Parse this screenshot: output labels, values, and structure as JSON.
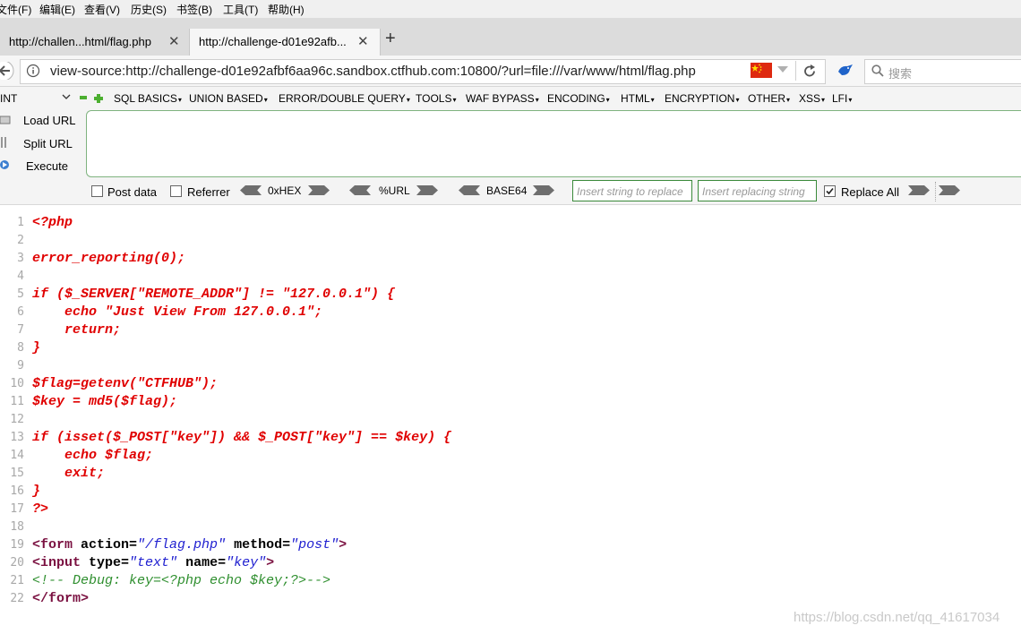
{
  "menu": [
    "文件(F)",
    "编辑(E)",
    "查看(V)",
    "历史(S)",
    "书签(B)",
    "工具(T)",
    "帮助(H)"
  ],
  "tabs": [
    {
      "title": "http://challen...html/flag.php",
      "active": false
    },
    {
      "title": "http://challenge-d01e92afb...",
      "active": true
    }
  ],
  "address": {
    "url": "view-source:http://challenge-d01e92afbf6aa96c.sandbox.ctfhub.com:10800/?url=file:///var/www/html/flag.php"
  },
  "search": {
    "placeholder": "搜索"
  },
  "hackbar": {
    "select_value": "INT",
    "menus": [
      "SQL BASICS",
      "UNION BASED",
      "ERROR/DOUBLE QUERY",
      "TOOLS",
      "WAF BYPASS",
      "ENCODING",
      "HTML",
      "ENCRYPTION",
      "OTHER",
      "XSS",
      "LFI"
    ],
    "load_url": "Load URL",
    "split_url": "Split URL",
    "execute": "Execute",
    "post_data": "Post data",
    "referrer": "Referrer",
    "hex": "0xHEX",
    "url_enc": "%URL",
    "base64": "BASE64",
    "replace_placeholder": "Insert string to replace",
    "replacing_placeholder": "Insert replacing string",
    "replace_all": "Replace All",
    "replace_all_checked": true
  },
  "source_lines": [
    "<?php",
    "",
    "error_reporting(0);",
    "",
    "if ($_SERVER[\"REMOTE_ADDR\"] != \"127.0.0.1\") {",
    "    echo \"Just View From 127.0.0.1\";",
    "    return;",
    "}",
    "",
    "$flag=getenv(\"CTFHUB\");",
    "$key = md5($flag);",
    "",
    "if (isset($_POST[\"key\"]) && $_POST[\"key\"] == $key) {",
    "    echo $flag;",
    "    exit;",
    "}",
    "?>",
    "",
    "<form action=\"/flag.php\" method=\"post\">",
    "<input type=\"text\" name=\"key\">",
    "<!-- Debug: key=<?php echo $key;?>-->",
    "</form>"
  ],
  "watermark": "https://blog.csdn.net/qq_41617034",
  "colors": {
    "php": "#e00000",
    "tag": "#7a1040",
    "string": "#2020d0",
    "comment": "#2f8f2f",
    "hackbar_border": "#3a8a3a"
  },
  "icons": [
    "back-arrow-icon",
    "info-icon",
    "china-flag-icon",
    "dropdown-icon",
    "reload-icon",
    "bird-icon",
    "search-icon",
    "close-icon",
    "new-tab-icon"
  ]
}
